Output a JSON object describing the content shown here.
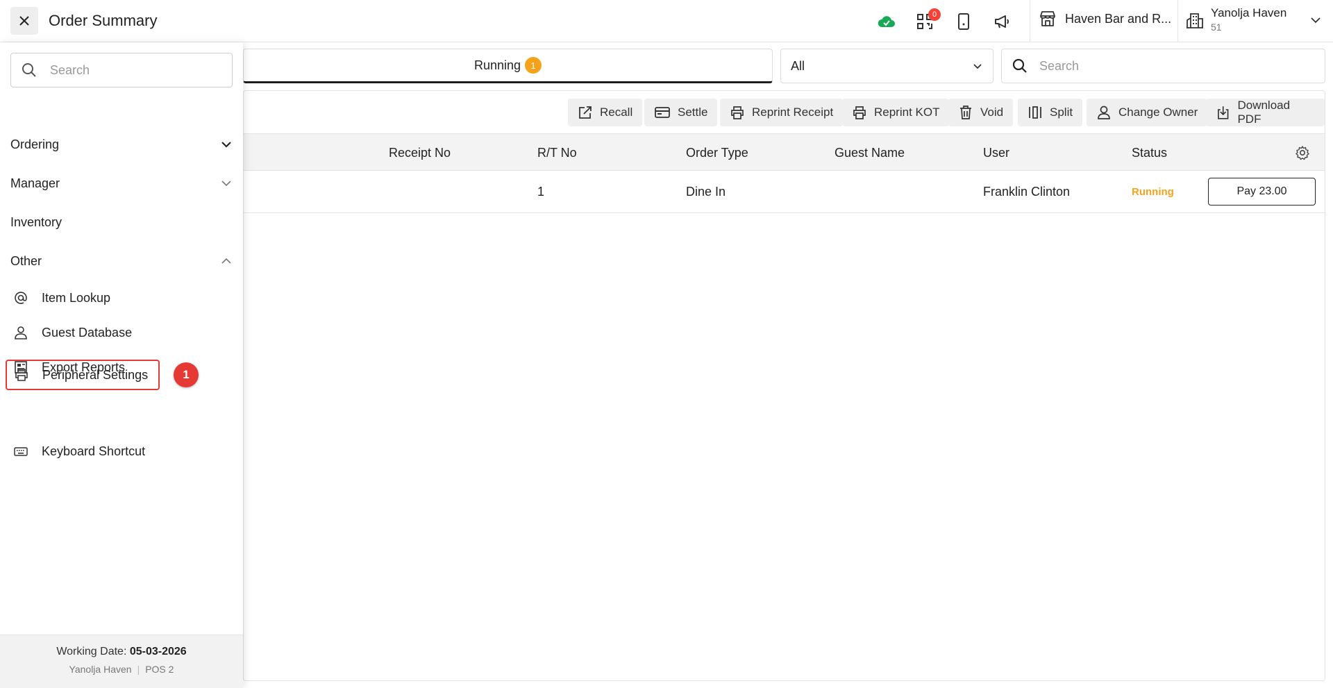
{
  "header": {
    "title": "Order Summary",
    "notification_count": "0",
    "store_name": "Haven Bar and R...",
    "user": {
      "name": "Yanolja Haven",
      "sub": "51"
    }
  },
  "tabs": {
    "running_label": "Running",
    "running_count": "1"
  },
  "filter": {
    "selected": "All"
  },
  "main_search": {
    "placeholder": "Search"
  },
  "toolbar": {
    "recall": "Recall",
    "settle": "Settle",
    "reprint_receipt": "Reprint Receipt",
    "reprint_kot": "Reprint KOT",
    "void": "Void",
    "split": "Split",
    "change_owner": "Change Owner",
    "download_pdf": "Download PDF"
  },
  "table": {
    "columns": [
      "Receipt No",
      "R/T No",
      "Order Type",
      "Guest Name",
      "User",
      "Status"
    ],
    "rows": [
      {
        "receipt_no": "",
        "rt_no": "1",
        "order_type": "Dine In",
        "guest_name": "",
        "user": "Franklin Clinton",
        "status": "Running",
        "action": "Pay 23.00"
      }
    ]
  },
  "drawer": {
    "search_placeholder": "Search",
    "sections": {
      "ordering": "Ordering",
      "manager": "Manager",
      "inventory": "Inventory",
      "other": "Other"
    },
    "other_items": [
      {
        "label": "Item Lookup",
        "icon": "at-icon"
      },
      {
        "label": "Guest Database",
        "icon": "person-icon"
      },
      {
        "label": "Export Reports",
        "icon": "report-icon"
      },
      {
        "label": "Peripheral Settings",
        "icon": "printer-icon"
      },
      {
        "label": "Keyboard Shortcut",
        "icon": "keyboard-icon"
      }
    ],
    "step_badge": "1",
    "footer": {
      "working_date_label": "Working Date:",
      "working_date": "05-03-2026",
      "property": "Yanolja Haven",
      "pos": "POS 2"
    }
  },
  "colors": {
    "accent_orange": "#f5a21b",
    "highlight_red": "#e53935",
    "cloud_green": "#18a957"
  }
}
